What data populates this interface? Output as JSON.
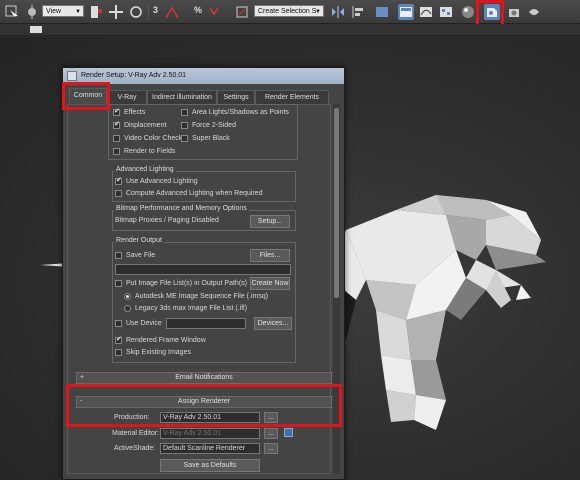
{
  "toolbar": {
    "view_dropdown": "View",
    "selection_set_dropdown": "Create Selection S",
    "snap_labels": [
      "3",
      "%"
    ],
    "render_setup_icon": "render-setup-icon",
    "accent": "#5b84b9",
    "highlight_color": "#e4131a"
  },
  "dialog": {
    "title": "Render Setup: V-Ray Adv 2.50.01",
    "tabs": [
      "Common",
      "V-Ray",
      "Indirect illumination",
      "Settings",
      "Render Elements"
    ],
    "active_tab": "Common",
    "options": {
      "effects": "Effects",
      "area_lights": "Area Lights/Shadows as Points",
      "displacement": "Displacement",
      "force_2sided": "Force 2-Sided",
      "video_color_check": "Video Color Check",
      "super_black": "Super Black",
      "render_to_fields": "Render to Fields"
    },
    "advanced_lighting": {
      "title": "Advanced Lighting",
      "use": "Use Advanced Lighting",
      "compute": "Compute Advanced Lighting when Required"
    },
    "bitmap": {
      "title": "Bitmap Performance and Memory Options",
      "label": "Bitmap Proxies / Paging Disabled",
      "setup_button": "Setup..."
    },
    "render_output": {
      "title": "Render Output",
      "save_file": "Save File",
      "files_button": "Files...",
      "put_image": "Put Image File List(s) in Output Path(s)",
      "create_now": "Create Now",
      "autodesk_me": "Autodesk ME Image Sequence File (.imsq)",
      "legacy": "Legacy 3ds max Image File List (.ifl)",
      "use_device": "Use Device",
      "devices_button": "Devices...",
      "rendered_frame_window": "Rendered Frame Window",
      "skip_existing": "Skip Existing Images"
    },
    "rollouts": {
      "email": "Email Notifications",
      "assign": "Assign Renderer"
    },
    "assign_renderer": {
      "production_label": "Production:",
      "production_value": "V-Ray Adv 2.50.01",
      "material_editor_label": "Material Editor:",
      "material_editor_value": "V-Ray Adv 2.50.01",
      "activeshade_label": "ActiveShade:",
      "activeshade_value": "Default Scanline Renderer",
      "ellipsis": "...",
      "save_defaults": "Save as Defaults"
    }
  }
}
